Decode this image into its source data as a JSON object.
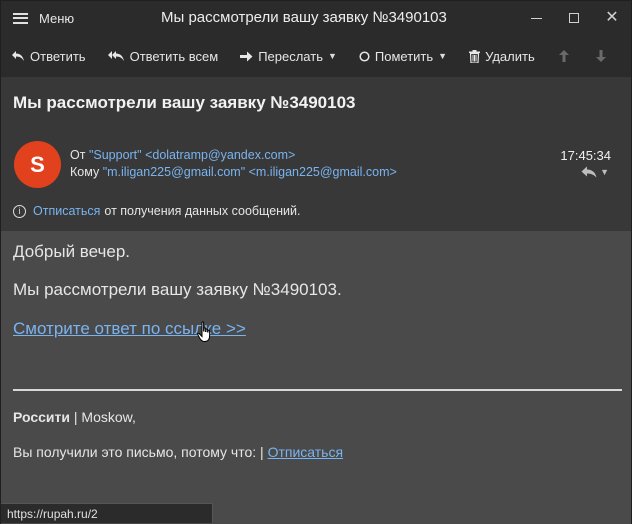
{
  "window": {
    "menu_label": "Меню",
    "title": "Мы рассмотрели вашу заявку №3490103"
  },
  "toolbar": {
    "reply": "Ответить",
    "reply_all": "Ответить всем",
    "forward": "Переслать",
    "mark": "Пометить",
    "delete": "Удалить"
  },
  "header": {
    "subject": "Мы рассмотрели вашу заявку №3490103",
    "avatar_letter": "S",
    "avatar_color": "#e2411d",
    "from_label": "От",
    "from_address": "\"Support\" <dolatramp@yandex.com>",
    "to_label": "Кому",
    "to_address": "\"m.iligan225@gmail.com\" <m.iligan225@gmail.com>",
    "time": "17:45:34",
    "unsubscribe_link": "Отписаться",
    "unsubscribe_text": "от получения данных сообщений."
  },
  "body": {
    "greeting": "Добрый вечер.",
    "paragraph": "Мы рассмотрели вашу заявку №3490103.",
    "link_text": "Смотрите ответ по ссылке >>",
    "footer_brand": "Россити",
    "footer_location": " | Moskow,",
    "footer_reason": "Вы получили это письмо, потому что: | ",
    "footer_link": "Отписаться"
  },
  "status": {
    "url": "https://rupah.ru/2"
  },
  "colors": {
    "link": "#7ab4f0",
    "toolbar_bg": "#2b2b2b",
    "header_bg": "#383838",
    "body_bg": "#4a4a4a"
  }
}
